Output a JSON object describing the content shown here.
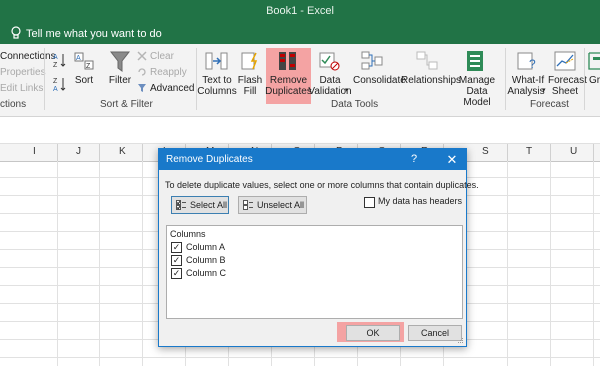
{
  "window": {
    "title": "Book1  -  Excel",
    "accent": "#217346"
  },
  "tell_me": {
    "text": "Tell me what you want to do"
  },
  "ribbon": {
    "get_transform": {
      "connections": "Connections",
      "properties": "Properties",
      "edit_links": "Edit Links",
      "group_label": "ctions"
    },
    "sort_filter": {
      "sort": "Sort",
      "filter": "Filter",
      "clear": "Clear",
      "reapply": "Reapply",
      "advanced": "Advanced",
      "group_label": "Sort & Filter"
    },
    "data_tools": {
      "text_to_columns": [
        "Text to",
        "Columns"
      ],
      "flash_fill": [
        "Flash",
        "Fill"
      ],
      "remove_duplicates": [
        "Remove",
        "Duplicates"
      ],
      "data_validation": [
        "Data",
        "Validation"
      ],
      "consolidate": "Consolidate",
      "relationships": "Relationships",
      "manage_data_model": [
        "Manage",
        "Data Model"
      ],
      "group_label": "Data Tools"
    },
    "forecast": {
      "what_if": [
        "What-If",
        "Analysis"
      ],
      "forecast_sheet": [
        "Forecast",
        "Sheet"
      ],
      "group_label": "Forecast",
      "group": "Gr"
    }
  },
  "columns": [
    "I",
    "J",
    "K",
    "L",
    "M",
    "N",
    "O",
    "P",
    "Q",
    "R",
    "S",
    "T",
    "U"
  ],
  "dialog": {
    "title": "Remove Duplicates",
    "help": "?",
    "close": "✕",
    "description": "To delete duplicate values, select one or more columns that contain duplicates.",
    "select_all": "Select All",
    "unselect_all": "Unselect All",
    "headers_label": "My data has headers",
    "headers_checked": false,
    "columns_heading": "Columns",
    "column_items": [
      {
        "label": "Column A",
        "checked": true
      },
      {
        "label": "Column B",
        "checked": true
      },
      {
        "label": "Column C",
        "checked": true
      }
    ],
    "ok": "OK",
    "cancel": "Cancel",
    "accent": "#1979ca"
  },
  "highlight_color": "#f4a3a3"
}
